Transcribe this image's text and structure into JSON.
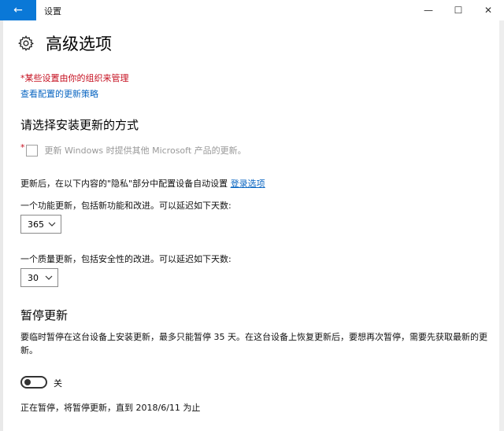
{
  "window": {
    "title": "设置",
    "back_icon": "←",
    "minimize_icon": "—",
    "maximize_icon": "☐",
    "close_icon": "✕"
  },
  "header": {
    "title": "高级选项",
    "icon": "gear-icon"
  },
  "managed_note": "*某些设置由你的组织来管理",
  "policy_link": "查看配置的更新策略",
  "install_section": {
    "title": "请选择安装更新的方式",
    "required_mark": "*",
    "checkbox_label": "更新 Windows 时提供其他 Microsoft 产品的更新。",
    "checkbox_checked": false,
    "privacy_text": "更新后，在以下内容的\"隐私\"部分中配置设备自动设置 ",
    "privacy_link": "登录选项",
    "feature_text": "一个功能更新，包括新功能和改进。可以延迟如下天数:",
    "feature_value": "365",
    "quality_text": "一个质量更新，包括安全性的改进。可以延迟如下天数:",
    "quality_value": "30"
  },
  "pause_section": {
    "title": "暂停更新",
    "description": "要临时暂停在这台设备上安装更新，最多只能暂停 35 天。在这台设备上恢复更新后，要想再次暂停，需要先获取最新的更新。",
    "toggle_state": "关",
    "toggle_on": false,
    "status": "正在暂停，将暂停更新，直到 2018/6/11 为止"
  },
  "colors": {
    "accent": "#0a78d7",
    "link": "#0a66c2",
    "warning": "#c50f1f"
  }
}
